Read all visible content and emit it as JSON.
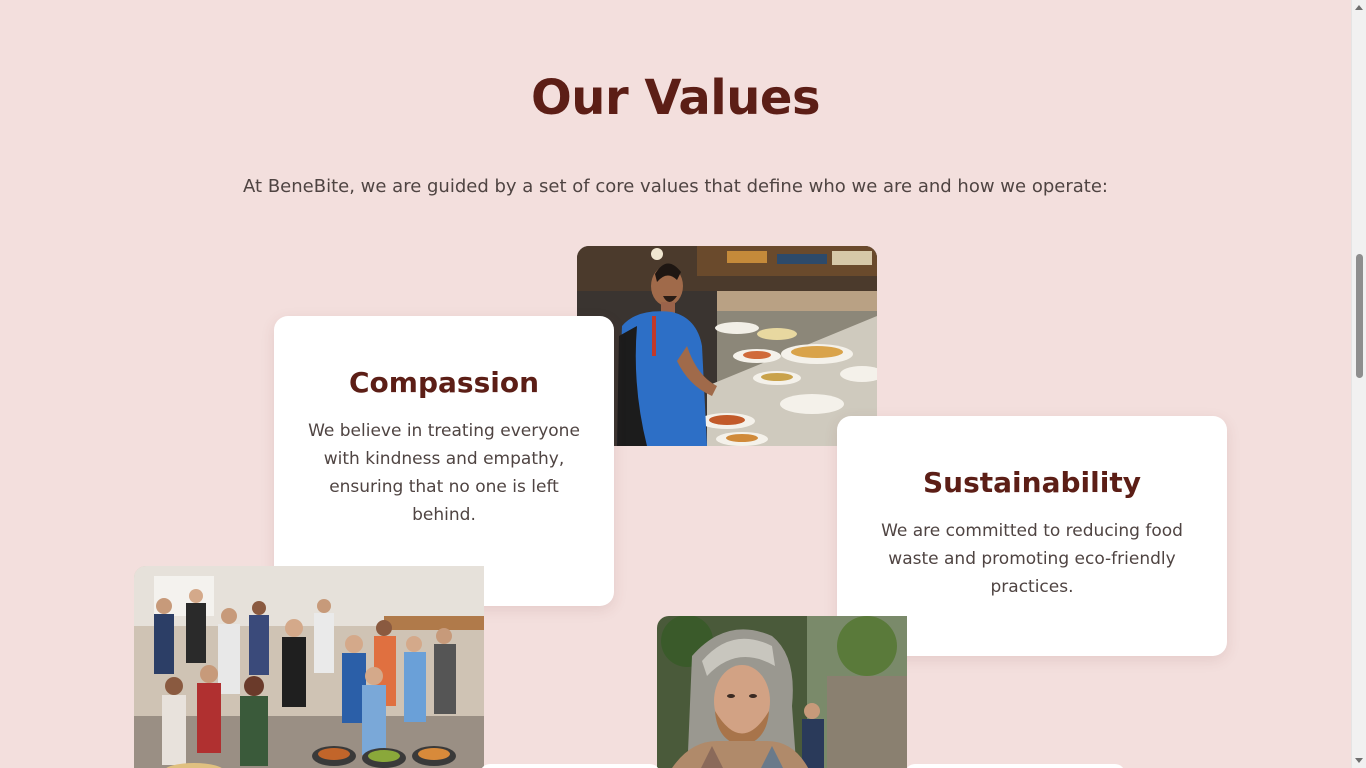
{
  "section": {
    "title": "Our Values",
    "intro": "At BeneBite, we are guided by a set of core values that define who we are and how we operate:"
  },
  "values": [
    {
      "title": "Compassion",
      "text": "We believe in treating everyone with kindness and empathy, ensuring that no one is left behind."
    },
    {
      "title": "Sustainability",
      "text": "We are committed to reducing food waste and promoting eco-friendly practices."
    }
  ],
  "images": {
    "buffet": "person serving food at buffet",
    "crowd": "crowd of people at food event",
    "hooded_man": "man in hooded jacket"
  },
  "colors": {
    "background": "#f3dfdd",
    "heading": "#5c1e16",
    "body_text": "#4f4442",
    "card": "#ffffff"
  }
}
